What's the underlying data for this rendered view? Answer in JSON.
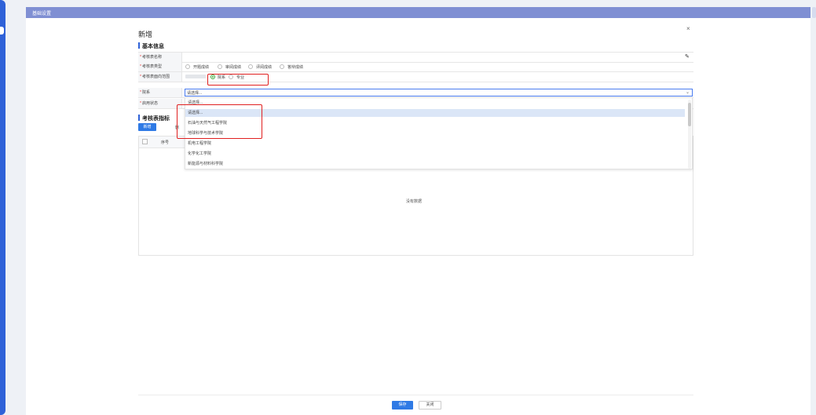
{
  "window": {
    "title": "基础设置"
  },
  "dialog": {
    "title": "新增",
    "close_icon": "×"
  },
  "basic_info": {
    "section_title": "基本信息",
    "fields": {
      "name": {
        "label": "考核表名称",
        "value": ""
      },
      "type": {
        "label": "考核表类型",
        "options": [
          "开题成绩",
          "审阅成绩",
          "评阅成绩",
          "答辩成绩"
        ]
      },
      "scope": {
        "label": "考核表面向范围",
        "options": [
          "院系",
          "专业"
        ],
        "selected": "院系"
      },
      "college": {
        "label": "院系",
        "placeholder": "请选择...",
        "dropdown": [
          "请选择...",
          "请选择...",
          "石油与天然气工程学院",
          "地球科学与技术学院",
          "机电工程学院",
          "化学化工学院",
          "新能源与材料科学院"
        ]
      },
      "status": {
        "label": "启用状态"
      }
    }
  },
  "indicators": {
    "section_title": "考核表指标",
    "add_label": "新增",
    "delete_label": "删",
    "columns": [
      "序号"
    ],
    "empty_text": "没有数据"
  },
  "footer": {
    "save_label": "保存",
    "close_label": "关闭"
  },
  "colors": {
    "accent": "#2f62d8",
    "titlebar": "#7f8fd3",
    "primary_button": "#2f7ae5",
    "highlight_box": "#e02020"
  }
}
